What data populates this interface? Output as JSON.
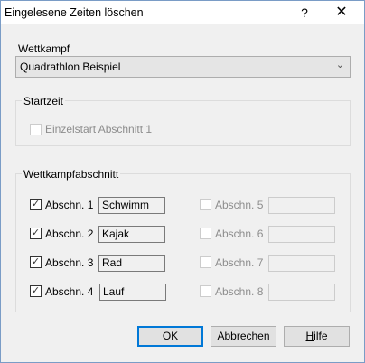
{
  "window": {
    "title": "Eingelesene Zeiten löschen",
    "help": "?",
    "close": "✕"
  },
  "wettkampf": {
    "label": "Wettkampf",
    "value": "Quadrathlon Beispiel"
  },
  "startzeit": {
    "legend": "Startzeit",
    "checkbox_label": "Einzelstart Abschnitt 1",
    "checked": false
  },
  "abschnitte": {
    "legend": "Wettkampfabschnitt",
    "items": [
      {
        "label": "Abschn. 1",
        "value": "Schwimm",
        "checked": true,
        "enabled": true
      },
      {
        "label": "Abschn. 2",
        "value": "Kajak",
        "checked": true,
        "enabled": true
      },
      {
        "label": "Abschn. 3",
        "value": "Rad",
        "checked": true,
        "enabled": true
      },
      {
        "label": "Abschn. 4",
        "value": "Lauf",
        "checked": true,
        "enabled": true
      },
      {
        "label": "Abschn. 5",
        "value": "",
        "checked": false,
        "enabled": false
      },
      {
        "label": "Abschn. 6",
        "value": "",
        "checked": false,
        "enabled": false
      },
      {
        "label": "Abschn. 7",
        "value": "",
        "checked": false,
        "enabled": false
      },
      {
        "label": "Abschn. 8",
        "value": "",
        "checked": false,
        "enabled": false
      }
    ]
  },
  "buttons": {
    "ok": "OK",
    "cancel": "Abbrechen",
    "help_pre": "",
    "help_u": "H",
    "help_rest": "ilfe"
  }
}
